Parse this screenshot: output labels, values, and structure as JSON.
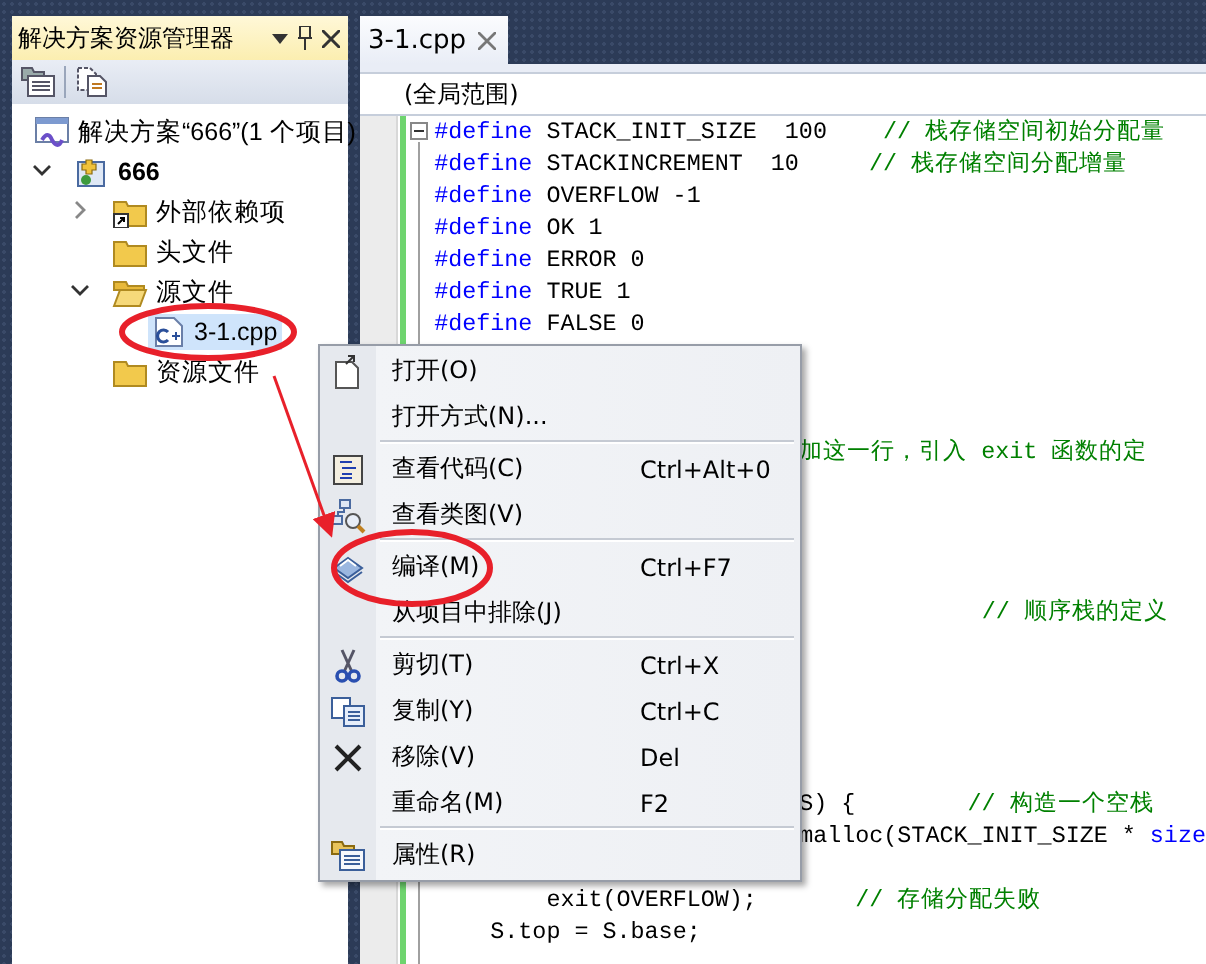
{
  "solution_explorer": {
    "title": "解决方案资源管理器",
    "tree": [
      {
        "label": "解决方案“666”(1 个项目)",
        "kind": "solution",
        "selected": false,
        "children": [
          {
            "label": "666",
            "kind": "project",
            "expanded": true,
            "selected": false,
            "children": [
              {
                "label": "外部依赖项",
                "kind": "references",
                "expanded": false,
                "selected": false
              },
              {
                "label": "头文件",
                "kind": "folder",
                "selected": false
              },
              {
                "label": "源文件",
                "kind": "folder",
                "expanded": true,
                "selected": false,
                "children": [
                  {
                    "label": "3-1.cpp",
                    "kind": "cpp",
                    "selected": true
                  }
                ]
              },
              {
                "label": "资源文件",
                "kind": "folder",
                "selected": false
              }
            ]
          }
        ]
      }
    ]
  },
  "editor": {
    "tab": {
      "label": "3-1.cpp",
      "selected": true
    },
    "scope": "(全局范围)",
    "lines": [
      {
        "kind": "code",
        "segments": [
          {
            "kind": "keyword",
            "text": "#define"
          },
          {
            "kind": "plain",
            "text": "STACK_INIT_SIZE  100"
          },
          {
            "kind": "comment",
            "text": "// 栈存储空间初始分配量"
          }
        ]
      },
      {
        "kind": "code",
        "segments": [
          {
            "kind": "keyword",
            "text": "#define"
          },
          {
            "kind": "plain",
            "text": "STACKINCREMENT  10"
          },
          {
            "kind": "comment",
            "text": "// 栈存储空间分配增量"
          }
        ]
      },
      {
        "kind": "code",
        "segments": [
          {
            "kind": "keyword",
            "text": "#define"
          },
          {
            "kind": "plain",
            "text": "OVERFLOW -1"
          }
        ]
      },
      {
        "kind": "code",
        "segments": [
          {
            "kind": "keyword",
            "text": "#define"
          },
          {
            "kind": "plain",
            "text": "OK 1"
          }
        ]
      },
      {
        "kind": "code",
        "segments": [
          {
            "kind": "keyword",
            "text": "#define"
          },
          {
            "kind": "plain",
            "text": "ERROR 0"
          }
        ]
      },
      {
        "kind": "code",
        "segments": [
          {
            "kind": "keyword",
            "text": "#define"
          },
          {
            "kind": "plain",
            "text": "TRUE 1"
          }
        ]
      },
      {
        "kind": "code",
        "segments": [
          {
            "kind": "keyword",
            "text": "#define"
          },
          {
            "kind": "plain",
            "text": "FALSE 0"
          }
        ]
      },
      {
        "kind": "blank"
      },
      {
        "kind": "blank"
      },
      {
        "kind": "blank"
      },
      {
        "kind": "code",
        "segments": [
          {
            "kind": "comment",
            "text": "加这一行，引入 exit 函数的定"
          }
        ]
      },
      {
        "kind": "blank"
      },
      {
        "kind": "blank"
      },
      {
        "kind": "blank"
      },
      {
        "kind": "blank"
      },
      {
        "kind": "code",
        "segments": [
          {
            "kind": "comment",
            "text": "// 顺序栈的定义"
          }
        ]
      },
      {
        "kind": "blank"
      },
      {
        "kind": "blank"
      },
      {
        "kind": "blank"
      },
      {
        "kind": "blank"
      },
      {
        "kind": "blank"
      },
      {
        "kind": "code",
        "segments": [
          {
            "kind": "plain",
            "text": "S) {"
          },
          {
            "kind": "comment",
            "text": "// 构造一个空栈"
          }
        ]
      },
      {
        "kind": "code",
        "segments": [
          {
            "kind": "plain",
            "text": "malloc(STACK_INIT_SIZE *"
          },
          {
            "kind": "keyword",
            "text": "size"
          }
        ]
      },
      {
        "kind": "blank"
      },
      {
        "kind": "code",
        "segments": [
          {
            "kind": "plain",
            "text": "exit(OVERFLOW);"
          },
          {
            "kind": "comment",
            "text": "// 存储分配失败"
          }
        ]
      },
      {
        "kind": "code",
        "segments": [
          {
            "kind": "plain",
            "text": "S.top = S.base;"
          }
        ]
      }
    ]
  },
  "context_menu": {
    "items": [
      {
        "kind": "item",
        "label": "打开(O)"
      },
      {
        "kind": "item",
        "label": "打开方式(N)..."
      },
      {
        "kind": "separator"
      },
      {
        "kind": "item",
        "label": "查看代码(C)",
        "shortcut": "Ctrl+Alt+0"
      },
      {
        "kind": "item",
        "label": "查看类图(V)"
      },
      {
        "kind": "separator"
      },
      {
        "kind": "item",
        "label": "编译(M)",
        "shortcut": "Ctrl+F7"
      },
      {
        "kind": "item",
        "label": "从项目中排除(J)"
      },
      {
        "kind": "separator"
      },
      {
        "kind": "item",
        "label": "剪切(T)",
        "shortcut": "Ctrl+X"
      },
      {
        "kind": "item",
        "label": "复制(Y)",
        "shortcut": "Ctrl+C"
      },
      {
        "kind": "item",
        "label": "移除(V)",
        "shortcut": "Del"
      },
      {
        "kind": "item",
        "label": "重命名(M)",
        "shortcut": "F2"
      },
      {
        "kind": "separator"
      },
      {
        "kind": "item",
        "label": "属性(R)"
      }
    ]
  }
}
